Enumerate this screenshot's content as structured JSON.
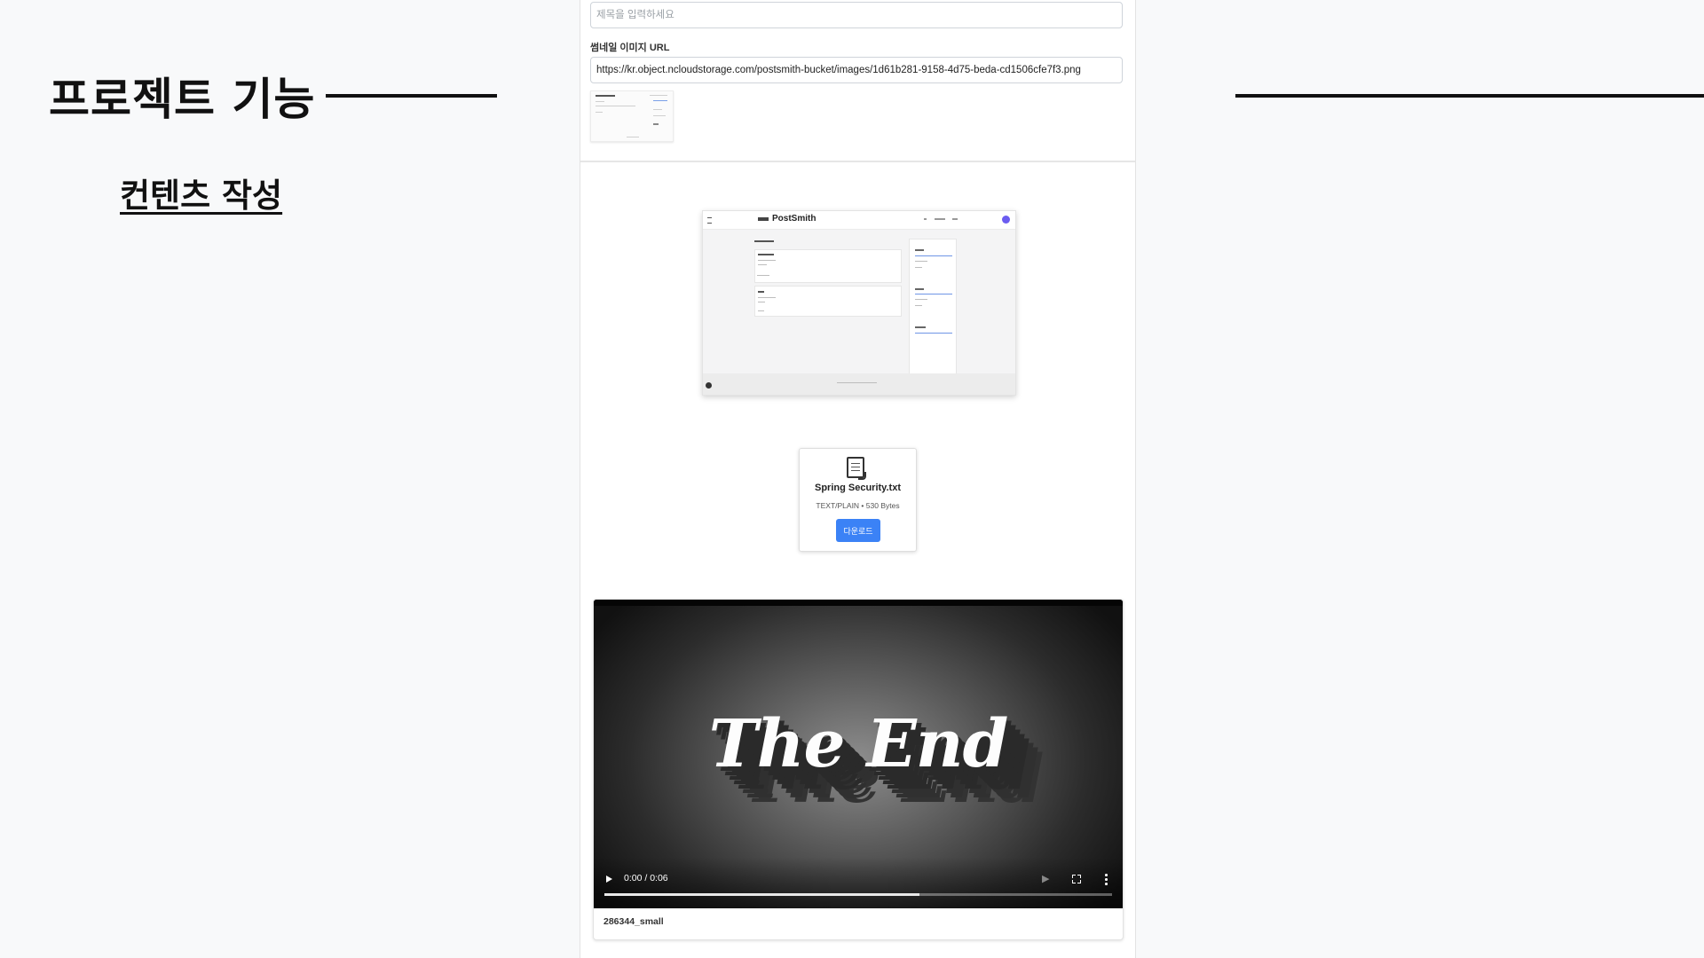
{
  "slide": {
    "title": "프로젝트 기능",
    "subtitle": "컨텐츠 작성"
  },
  "form": {
    "title_placeholder": "제목을 입력하세요",
    "thumbnail_label": "썸네일 이미지 URL",
    "thumbnail_url": "https://kr.object.ncloudstorage.com/postsmith-bucket/images/1d61b281-9158-4d75-beda-cd1506cfe7f3.png"
  },
  "embedded_screenshot": {
    "brand": "PostSmith"
  },
  "file_attachment": {
    "icon": "document-icon",
    "name": "Spring Security.txt",
    "meta": "TEXT/PLAIN • 530 Bytes",
    "download_label": "다운로드"
  },
  "video": {
    "frame_text": "The End",
    "time": "0:00 / 0:06",
    "progress": 0.62,
    "caption": "286344_small"
  },
  "colors": {
    "accent": "#3b82f6",
    "avatar": "#6b5cf0",
    "slide_bg": "#f8f9fa"
  }
}
